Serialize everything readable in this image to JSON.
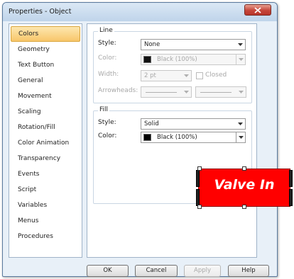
{
  "window": {
    "title": "Properties - Object"
  },
  "sidebar": {
    "items": [
      {
        "label": "Colors",
        "selected": true
      },
      {
        "label": "Geometry"
      },
      {
        "label": "Text Button"
      },
      {
        "label": "General"
      },
      {
        "label": "Movement"
      },
      {
        "label": "Scaling"
      },
      {
        "label": "Rotation/Fill"
      },
      {
        "label": "Color Animation"
      },
      {
        "label": "Transparency"
      },
      {
        "label": "Events"
      },
      {
        "label": "Script"
      },
      {
        "label": "Variables"
      },
      {
        "label": "Menus"
      },
      {
        "label": "Procedures"
      }
    ]
  },
  "line_group": {
    "title": "Line",
    "style_label": "Style:",
    "style_value": "None",
    "color_label": "Color:",
    "color_value": "Black (100%)",
    "width_label": "Width:",
    "width_value": "2 pt",
    "closed_label": "Closed",
    "closed_checked": false,
    "arrowheads_label": "Arrowheads:"
  },
  "fill_group": {
    "title": "Fill",
    "style_label": "Style:",
    "style_value": "Solid",
    "color_label": "Color:",
    "color_value": "Black (100%)"
  },
  "buttons": {
    "ok": "OK",
    "cancel": "Cancel",
    "apply": "Apply",
    "help": "Help"
  },
  "canvas_object": {
    "label": "Valve In",
    "fill_color": "#ff0000",
    "text_color": "#ffffff"
  },
  "colors": {
    "selected_item": "#f8c66a",
    "close_button": "#c6463a"
  }
}
